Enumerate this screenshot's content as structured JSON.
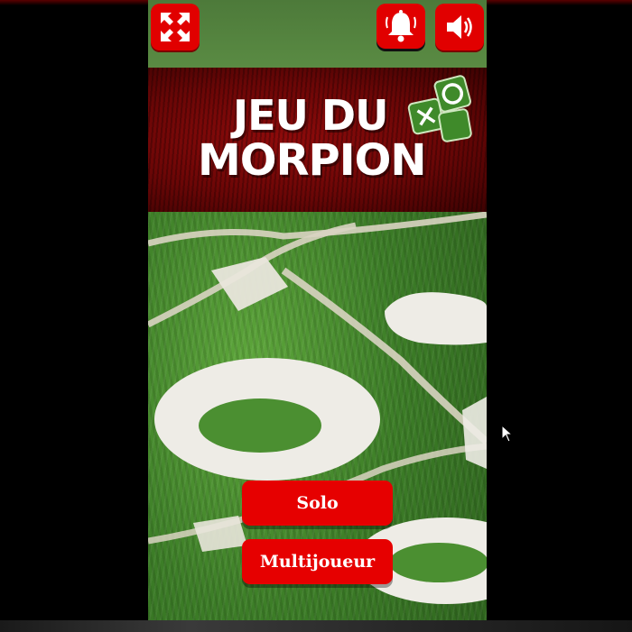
{
  "top_bar": {
    "fullscreen_icon": "fullscreen-arrows-icon",
    "notification_icon": "bell-icon",
    "sound_icon": "speaker-volume-icon"
  },
  "title": {
    "line1": "JEU DU",
    "line2": "MORPION",
    "logo_glyphs": [
      "X",
      "O"
    ]
  },
  "menu": {
    "solo_label": "Solo",
    "multi_label": "Multijoueur"
  },
  "colors": {
    "accent_red": "#e60000",
    "banner_red": "#7a0808",
    "grass_green": "#4a8f30"
  }
}
